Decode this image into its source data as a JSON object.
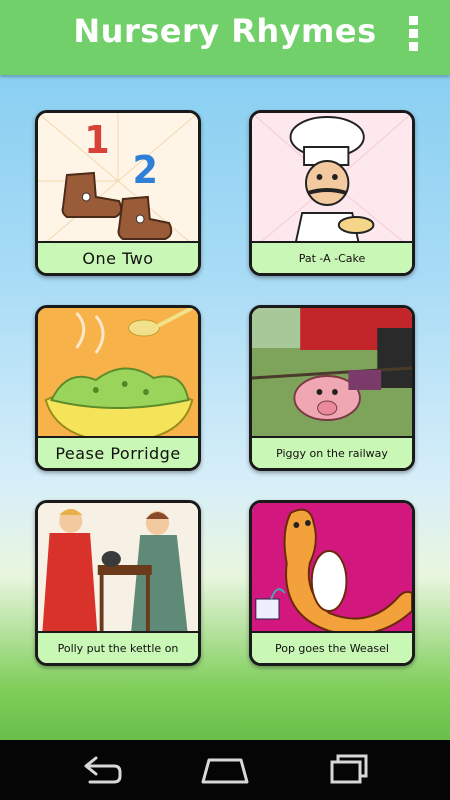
{
  "app": {
    "title": "Nursery Rhymes"
  },
  "icons": {
    "menu": "overflow-menu-icon",
    "back": "back-icon",
    "home": "home-icon",
    "recents": "recent-apps-icon"
  },
  "colors": {
    "appbar": "#72d06a",
    "caption_bg": "#c9f7b5",
    "navbar": "#050505"
  },
  "rhymes": [
    {
      "label": "One Two"
    },
    {
      "label": "Pat -A -Cake"
    },
    {
      "label": "Pease Porridge"
    },
    {
      "label": "Piggy on the railway"
    },
    {
      "label": "Polly put the kettle on"
    },
    {
      "label": "Pop goes the Weasel"
    }
  ]
}
